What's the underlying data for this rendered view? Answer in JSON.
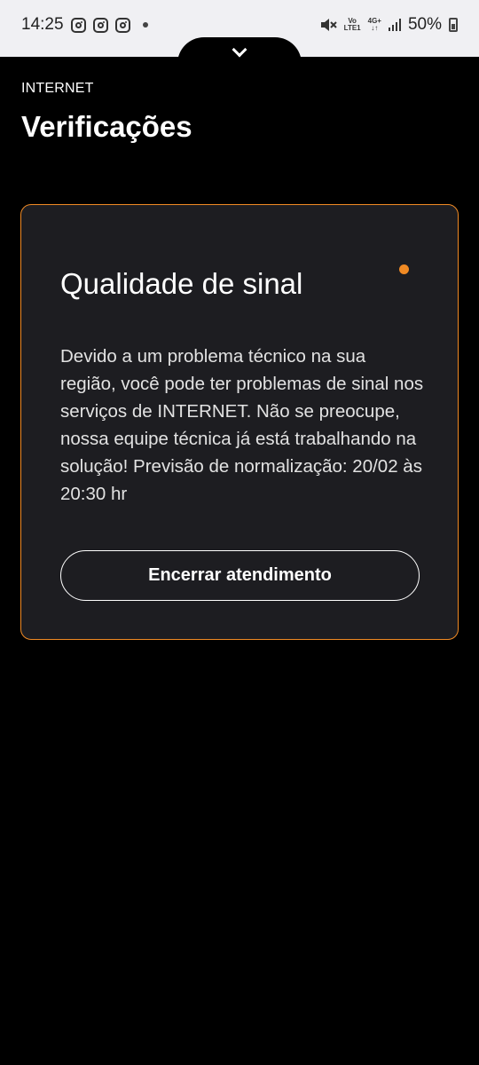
{
  "status_bar": {
    "time": "14:25",
    "network_top": "Vo",
    "network_bottom": "LTE1",
    "data_type": "4G+",
    "battery": "50%"
  },
  "header": {
    "section_label": "INTERNET",
    "title": "Verificações"
  },
  "card": {
    "title": "Qualidade de sinal",
    "message": "Devido a um problema técnico na sua região, você pode ter problemas de sinal nos serviços de INTERNET. Não se preocupe, nossa equipe técnica já está trabalhando na solução! Previsão de normalização: 20/02 às 20:30 hr",
    "button_label": "Encerrar atendimento",
    "accent_color": "#f08a24"
  }
}
